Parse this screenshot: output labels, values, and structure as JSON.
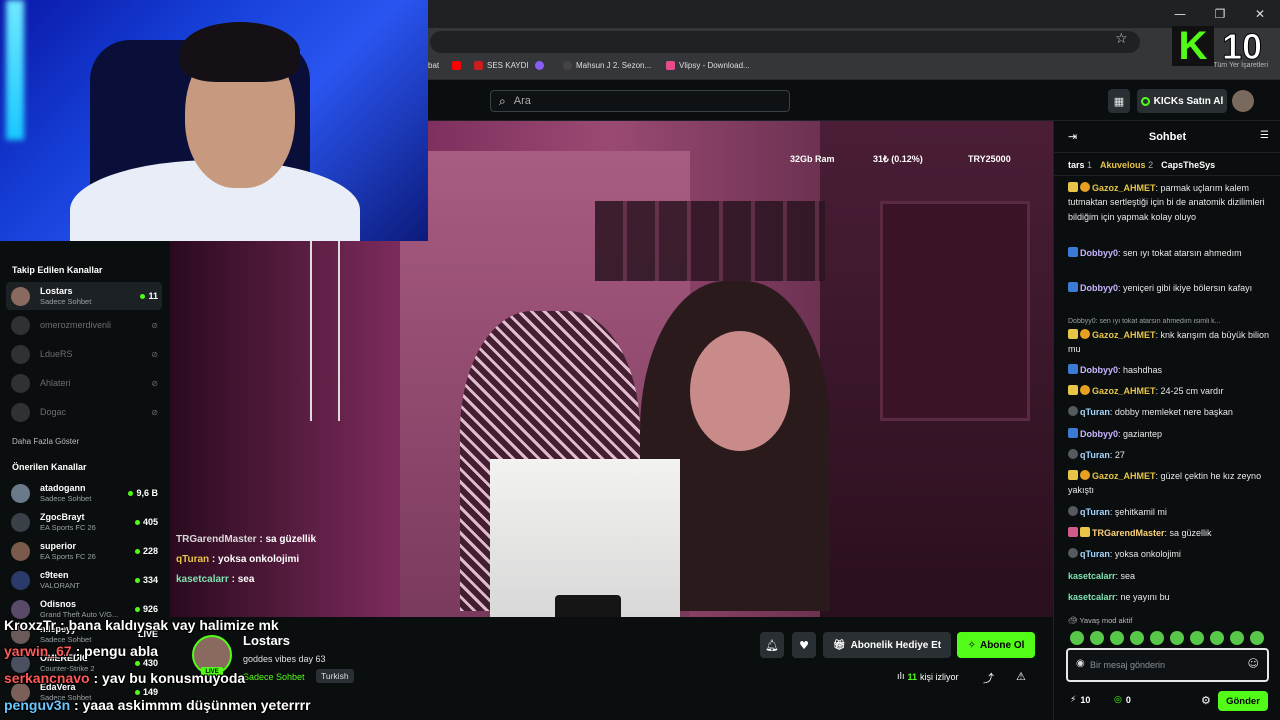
{
  "browser": {
    "bookmarks": [
      {
        "label": "bat",
        "color": "#8ab4f8"
      },
      {
        "label": "",
        "color": "#ff0000"
      },
      {
        "label": "SES KAYDI",
        "color": "#c81e1e"
      },
      {
        "label": "",
        "color": "#8a5cf6"
      },
      {
        "label": "Mahsun J 2. Sezon...",
        "color": "#444444"
      },
      {
        "label": "Vlipsy - Download...",
        "color": "#e84a8a"
      }
    ],
    "all_bookmarks": "Tüm Yer İşaretleri"
  },
  "overlay": {
    "kick_letter": "K",
    "kick_number": "10",
    "chat": [
      {
        "user": "KroxzTr",
        "text": " : bana kaldıysak vay halimize mk",
        "color": "white"
      },
      {
        "user": "yarwin_67",
        "text": " : pengu abla",
        "color": "red"
      },
      {
        "user": "serkancnavo",
        "text": " : yav bu konusmuyoda",
        "color": "red"
      },
      {
        "user": "penguv3n",
        "text": " : yaaa askimmm düşünmen yeterrrr",
        "color": "blue"
      }
    ]
  },
  "nav": {
    "search_placeholder": "Ara",
    "kicks_button": "KICKs Satın Al"
  },
  "sidebar": {
    "following_title": "Takip Edilen Kanallar",
    "following": [
      {
        "name": "Lostars",
        "sub": "Sadece Sohbet",
        "count": "11",
        "live": true
      },
      {
        "name": "omerozmerdivenli",
        "sub": "",
        "count": "",
        "live": false
      },
      {
        "name": "LdueRS",
        "sub": "",
        "count": "",
        "live": false
      },
      {
        "name": "Ahlateri",
        "sub": "",
        "count": "",
        "live": false
      },
      {
        "name": "Dogac",
        "sub": "",
        "count": "",
        "live": false
      }
    ],
    "show_more": "Daha Fazla Göster",
    "recommended_title": "Önerilen Kanallar",
    "recommended": [
      {
        "name": "atadogann",
        "sub": "Sadece Sohbet",
        "count": "9,6 B"
      },
      {
        "name": "ZgocBrayt",
        "sub": "EA Sports FC 26",
        "count": "405"
      },
      {
        "name": "superior",
        "sub": "EA Sports FC 26",
        "count": "228"
      },
      {
        "name": "c9teen",
        "sub": "VALORANT",
        "count": "334"
      },
      {
        "name": "Odisnos",
        "sub": "Grand Theft Auto V/G...",
        "count": "926"
      },
      {
        "name": "nilepeyy",
        "sub": "Sadece Sohbet",
        "count": "LIVE"
      },
      {
        "name": "OMEREDIC",
        "sub": "Counter-Strike 2",
        "count": "430"
      },
      {
        "name": "EdaVera",
        "sub": "Sadece Sohbet",
        "count": "149"
      }
    ]
  },
  "video": {
    "stats": [
      "32Gb Ram",
      "31₺ (0.12%)",
      "TRY25000"
    ],
    "chat": [
      {
        "user": "TRGarendMaster",
        "text": " : sa güzellik"
      },
      {
        "user": "qTuran",
        "text": " : yoksa onkolojimi"
      },
      {
        "user": "kasetcalarr",
        "text": " : sea"
      }
    ]
  },
  "stream": {
    "live_label": "LIVE",
    "channel": "Lostars",
    "title": "goddes vibes day 63",
    "category": "Sadece Sohbet",
    "tag": "Turkish",
    "gift_button": "Abonelik Hediye Et",
    "subscribe_button": "Abone Ol",
    "viewer_count": "11",
    "viewer_label": "kişi izliyor"
  },
  "chat": {
    "title": "Sohbet",
    "gifters": [
      {
        "name": "tars",
        "count": "1"
      },
      {
        "name": "Akuvelous",
        "count": "2"
      },
      {
        "name": "CapsTheSys",
        "count": ""
      }
    ],
    "messages": [
      {
        "user": "Gazoz_AHMET",
        "text": ": parmak uçlarım kalem tutmaktan sertleştiği için bi de anatomik dizilimleri bildiğim için yapmak kolay oluyo",
        "cls": "u-gazoz",
        "badges": [
          "#e8c547",
          "#e8a020"
        ]
      },
      {
        "user": "Dobbyy0",
        "text": ": sen ıyı tokat atarsın ahmedım",
        "cls": "u-dobby",
        "badges": [
          "#3a7bd5"
        ]
      },
      {
        "user": "Dobbyy0",
        "text": ": yeniçeri gibi ikiye bölersın kafayı",
        "cls": "u-dobby",
        "badges": [
          "#3a7bd5"
        ]
      },
      {
        "user": "Gazoz_AHMET",
        "text": ": knk karışım da büyük bilion mu",
        "cls": "u-gazoz",
        "badges": [
          "#e8c547",
          "#e8a020"
        ]
      },
      {
        "user": "Dobbyy0",
        "text": ": hashdhas",
        "cls": "u-dobby",
        "badges": [
          "#3a7bd5"
        ]
      },
      {
        "user": "Gazoz_AHMET",
        "text": ": 24-25 cm vardır",
        "cls": "u-gazoz",
        "badges": [
          "#e8c547",
          "#e8a020"
        ]
      },
      {
        "user": "qTuran",
        "text": ": dobby memleket nere başkan",
        "cls": "u-qturan",
        "badges": [
          "#555a60"
        ]
      },
      {
        "user": "Dobbyy0",
        "text": ": gaziantep",
        "cls": "u-dobby",
        "badges": [
          "#3a7bd5"
        ]
      },
      {
        "user": "qTuran",
        "text": ": 27",
        "cls": "u-qturan",
        "badges": [
          "#555a60"
        ]
      },
      {
        "user": "Gazoz_AHMET",
        "text": ": güzel çektin he kız zeyno yakıştı",
        "cls": "u-gazoz",
        "badges": [
          "#e8c547",
          "#e8a020"
        ]
      },
      {
        "user": "qTuran",
        "text": ": şehitkamil mi",
        "cls": "u-qturan",
        "badges": [
          "#555a60"
        ]
      },
      {
        "user": "TRGarendMaster",
        "text": ": sa güzellik",
        "cls": "u-trg",
        "badges": [
          "#d05a8a",
          "#e8c547"
        ]
      },
      {
        "user": "qTuran",
        "text": ": yoksa onkolojimi",
        "cls": "u-qturan",
        "badges": [
          "#555a60"
        ]
      },
      {
        "user": "kasetcalarr",
        "text": ": sea",
        "cls": "u-kaset",
        "badges": []
      },
      {
        "user": "kasetcalarr",
        "text": ": ne yayını bu",
        "cls": "u-kaset",
        "badges": []
      }
    ],
    "reply_preview": "Dobbyy0: sen ıyı tokat atarsın ahmedım isimli k...",
    "slow_mode": "Yavaş mod aktif",
    "input_placeholder": "Bir mesaj gönderin",
    "footer_count_1": "10",
    "footer_count_2": "0",
    "send_button": "Gönder"
  },
  "colors": {
    "accent": "#53fc18",
    "background": "#0b0e0f"
  }
}
